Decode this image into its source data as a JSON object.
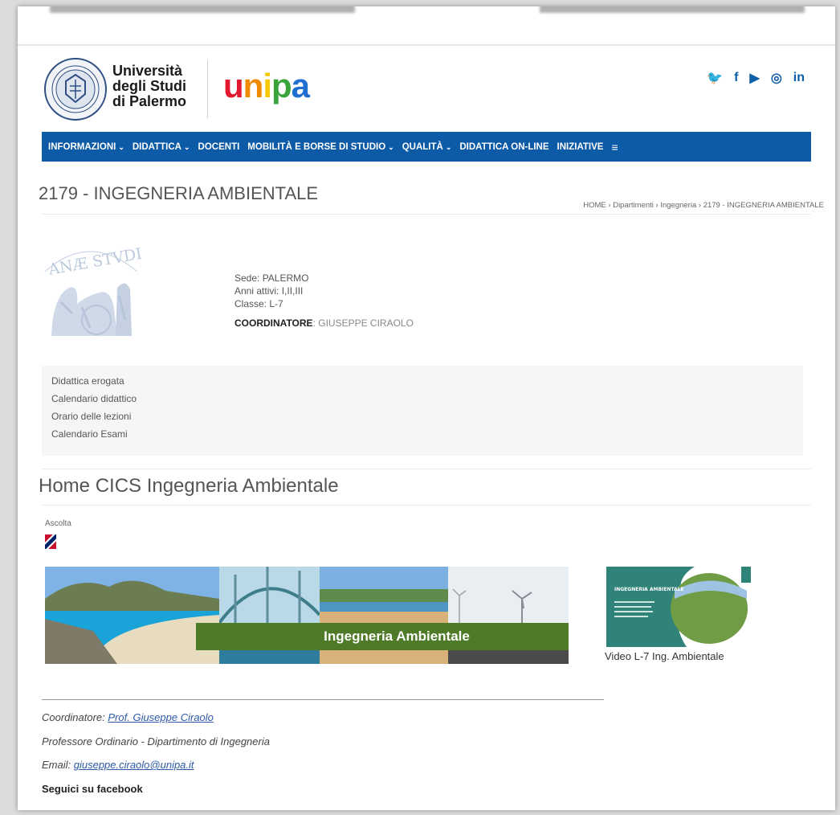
{
  "header": {
    "university_name": [
      "Università",
      "degli Studi",
      "di Palermo"
    ],
    "unipa_logo_text": "unipa",
    "social_icons": [
      "twitter-icon",
      "facebook-icon",
      "youtube-icon",
      "instagram-icon",
      "linkedin-icon"
    ],
    "social_glyphs": [
      "🐦",
      "f",
      "▶",
      "◎",
      "in"
    ]
  },
  "nav": {
    "items": [
      {
        "label": "INFORMAZIONI",
        "chev": "⌄"
      },
      {
        "label": "DIDATTICA",
        "chev": "⌄"
      },
      {
        "label": "DOCENTI",
        "chev": ""
      },
      {
        "label": "MOBILITÀ E BORSE DI STUDIO",
        "chev": "⌄"
      },
      {
        "label": "QUALITÀ",
        "chev": "⌄"
      },
      {
        "label": "DIDATTICA ON-LINE",
        "chev": ""
      },
      {
        "label": "INIZIATIVE",
        "chev": ""
      }
    ],
    "menu_glyph": "≡",
    "brand_color": "#0d5aa7"
  },
  "page": {
    "title": "2179 - INGEGNERIA AMBIENTALE",
    "breadcrumb": [
      "HOME",
      "Dipartimenti",
      "Ingegneria",
      "2179 - INGEGNERIA AMBIENTALE"
    ],
    "breadcrumb_sep": "›"
  },
  "info": {
    "sede": "Sede: PALERMO",
    "anni": "Anni attivi: I,II,III",
    "classe": "Classe: L-7",
    "coord_label": "COORDINATORE",
    "coord_value": ": GIUSEPPE CIRAOLO"
  },
  "links": [
    "Didattica erogata",
    "Calendario didattico",
    "Orario delle lezioni",
    "Calendario Esami"
  ],
  "home": {
    "title": "Home CICS Ingegneria Ambientale",
    "ascolta": "Ascolta",
    "banner_label": "Ingegneria Ambientale",
    "video_caption": "Video L-7 Ing. Ambientale",
    "video_thumb_title": "INGEGNERIA AMBIENTALE"
  },
  "contacts": {
    "coordinatore_label": "Coordinatore: ",
    "coordinatore_name": "Prof. Giuseppe Ciraolo",
    "role": "Professore Ordinario - Dipartimento di Ingegneria",
    "email_label": "Email: ",
    "email": "giuseppe.ciraolo@unipa.it",
    "facebook": "Seguici su facebook"
  }
}
